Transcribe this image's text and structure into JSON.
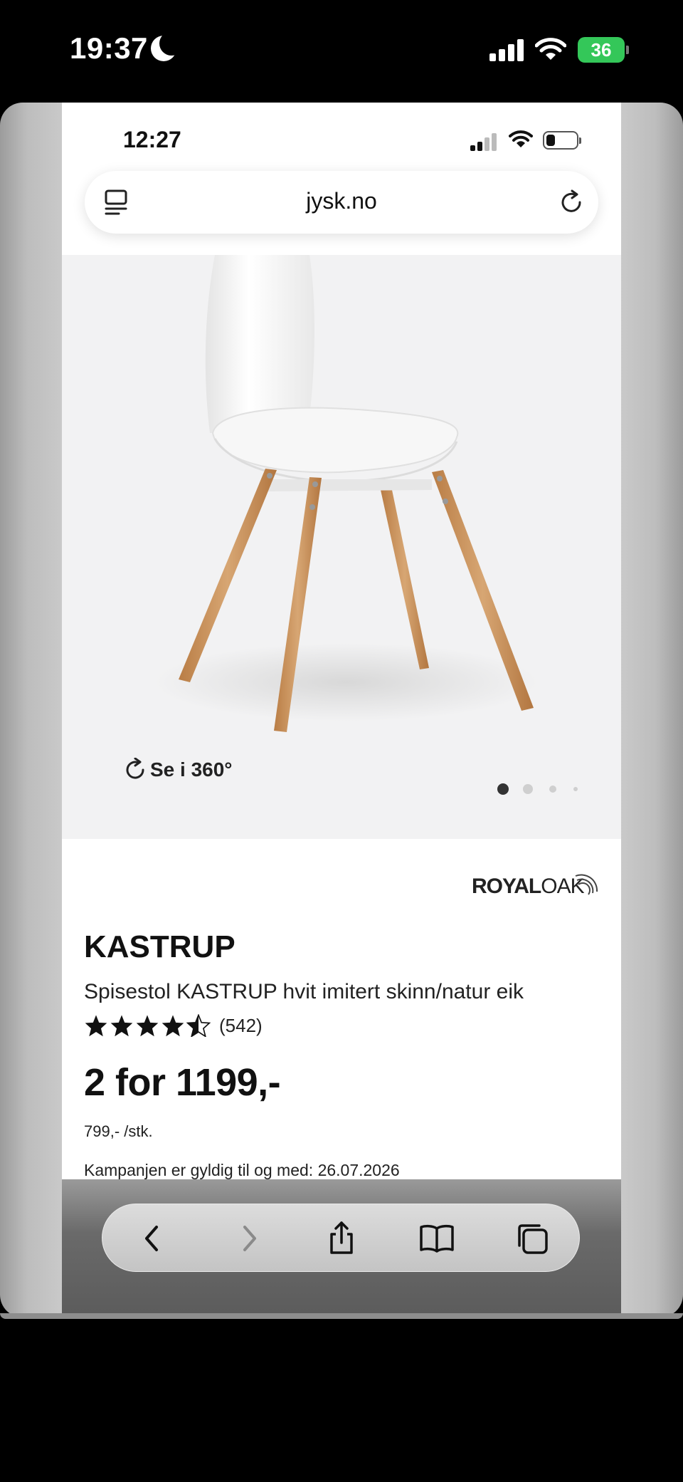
{
  "outer_status": {
    "time": "19:37",
    "battery": "36"
  },
  "browser": {
    "status_time": "12:27",
    "url": "jysk.no"
  },
  "gallery": {
    "view360_label": "Se i 360°",
    "page_dots": 4,
    "active_dot": 1
  },
  "brand": {
    "logo_text_bold": "ROYAL",
    "logo_text_light": "OAK"
  },
  "product": {
    "title": "KASTRUP",
    "subtitle": "Spisestol KASTRUP hvit imitert skinn/natur eik",
    "rating_stars": 4.5,
    "rating_count": "(542)",
    "price": "2 for 1199,-",
    "unit_price": "799,- /stk.",
    "campaign": "Kampanjen er gyldig til og med: 26.07.2026"
  },
  "toolbar": {
    "buttons": [
      "back-icon",
      "forward-icon",
      "share-icon",
      "bookmarks-icon",
      "tabs-icon"
    ]
  },
  "colors": {
    "battery_green": "#34c759",
    "page_bg": "#ffffff",
    "image_bg": "#f2f2f3",
    "wood": "#c9955e"
  }
}
